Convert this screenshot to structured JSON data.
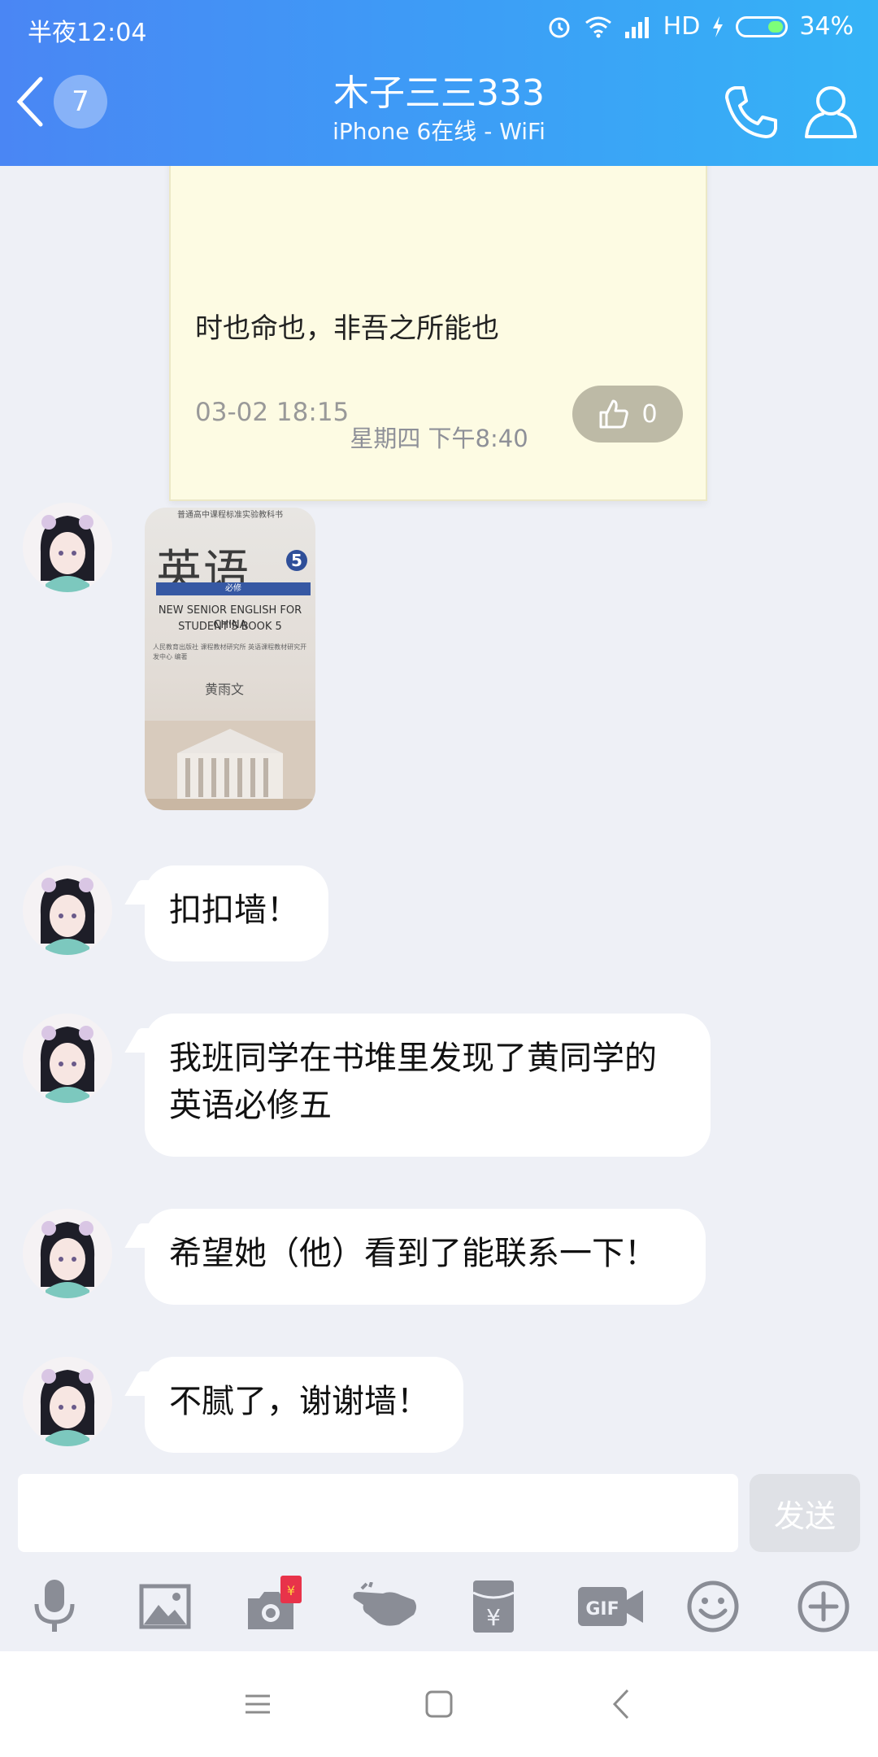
{
  "status_bar": {
    "time": "半夜12:04",
    "network": "HD",
    "battery": "34%"
  },
  "header": {
    "unread_count": "7",
    "contact_name": "木子三三333",
    "contact_status": "iPhone 6在线 - WiFi"
  },
  "note_card": {
    "text": "时也命也，非吾之所能也",
    "date": "03-02 18:15",
    "likes": "0"
  },
  "timestamp": "星期四 下午8:40",
  "book_image": {
    "header_line": "普通高中课程标准实验教科书",
    "title": "英语",
    "number": "5",
    "band_text": "必修",
    "subtitle_1": "NEW SENIOR ENGLISH FOR CHINA",
    "subtitle_2": "STUDENT'S BOOK 5",
    "publishers": "人民教育出版社 课程教材研究所 英语课程教材研究开发中心 编著",
    "signature": "黄雨文"
  },
  "messages": [
    {
      "text": "扣扣墙！"
    },
    {
      "text": "我班同学在书堆里发现了黄同学的英语必修五"
    },
    {
      "text": "希望她（他）看到了能联系一下！"
    },
    {
      "text": "不腻了，谢谢墙！"
    }
  ],
  "input": {
    "value": "",
    "send_label": "发送"
  },
  "toolbar_icons": [
    "mic-icon",
    "image-icon",
    "camera-redpacket-icon",
    "poke-icon",
    "redpacket-icon",
    "gif-icon",
    "emoji-icon",
    "plus-icon"
  ],
  "colors": {
    "header_start": "#4a86f4",
    "header_end": "#35b3f6",
    "background": "#eef0f6",
    "toolbar_icon": "#8a8d96"
  }
}
